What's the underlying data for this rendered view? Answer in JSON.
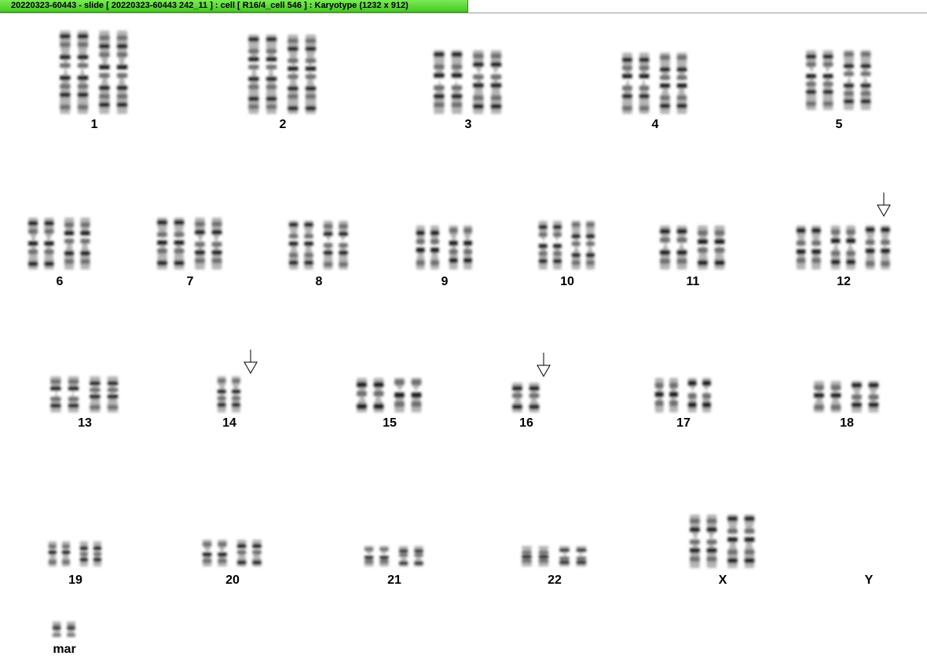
{
  "window": {
    "title": "20220323-60443 - slide [ 20220323-60443 242_11 ] : cell [ R16/4_cell 546 ] : Karyotype  (1232 x 912)"
  },
  "karyotype": {
    "colors": {
      "chromatin_dark": "#1e1e1e",
      "chromatin_mid": "#6e6e6e",
      "chromatin_light": "#b4b4b4"
    },
    "arrow_icon": "down-arrow-icon",
    "groups": [
      {
        "label": "1",
        "count": 2,
        "flagged": false
      },
      {
        "label": "2",
        "count": 2,
        "flagged": false
      },
      {
        "label": "3",
        "count": 2,
        "flagged": false
      },
      {
        "label": "4",
        "count": 2,
        "flagged": false
      },
      {
        "label": "5",
        "count": 2,
        "flagged": false
      },
      {
        "label": "6",
        "count": 2,
        "flagged": false
      },
      {
        "label": "7",
        "count": 2,
        "flagged": false
      },
      {
        "label": "8",
        "count": 2,
        "flagged": false
      },
      {
        "label": "9",
        "count": 2,
        "flagged": false
      },
      {
        "label": "10",
        "count": 2,
        "flagged": false
      },
      {
        "label": "11",
        "count": 2,
        "flagged": false
      },
      {
        "label": "12",
        "count": 3,
        "flagged": true
      },
      {
        "label": "13",
        "count": 2,
        "flagged": false
      },
      {
        "label": "14",
        "count": 1,
        "flagged": true
      },
      {
        "label": "15",
        "count": 2,
        "flagged": false
      },
      {
        "label": "16",
        "count": 1,
        "flagged": true
      },
      {
        "label": "17",
        "count": 2,
        "flagged": false
      },
      {
        "label": "18",
        "count": 2,
        "flagged": false
      },
      {
        "label": "19",
        "count": 2,
        "flagged": false
      },
      {
        "label": "20",
        "count": 2,
        "flagged": false
      },
      {
        "label": "21",
        "count": 2,
        "flagged": false
      },
      {
        "label": "22",
        "count": 2,
        "flagged": false
      },
      {
        "label": "X",
        "count": 2,
        "flagged": false
      },
      {
        "label": "Y",
        "count": 0,
        "flagged": false
      },
      {
        "label": "mar",
        "count": 1,
        "flagged": false
      }
    ]
  }
}
